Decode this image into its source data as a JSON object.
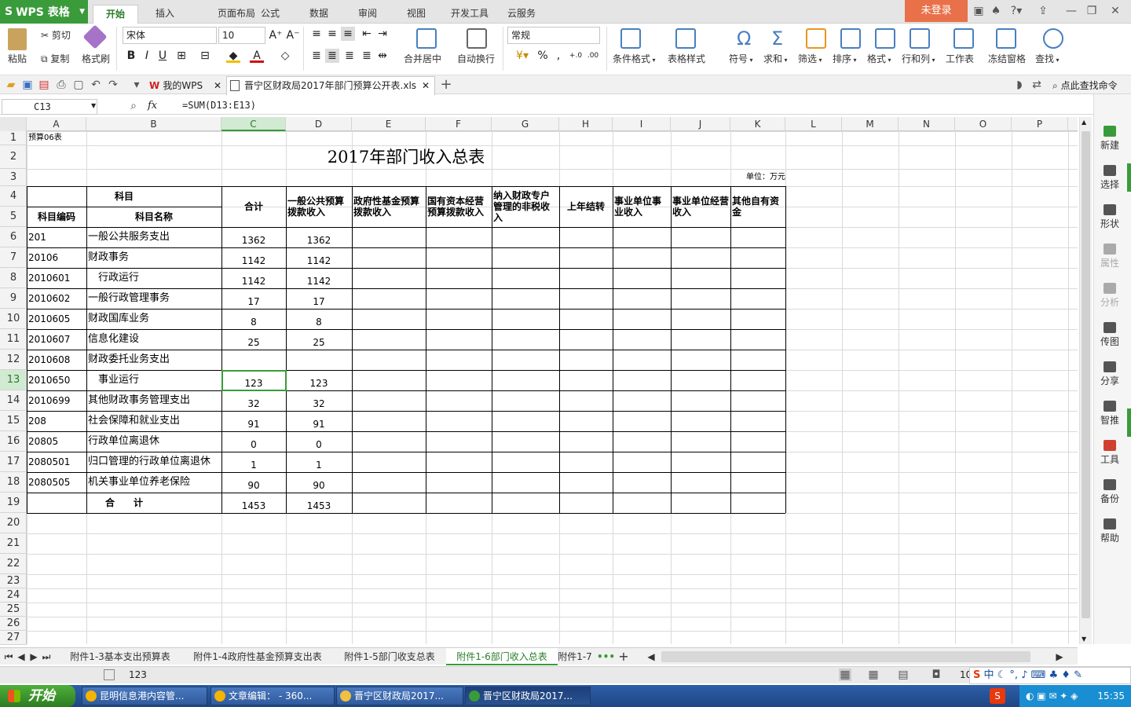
{
  "app": {
    "name": "WPS 表格",
    "login": "未登录"
  },
  "ribbon_tabs": [
    "开始",
    "插入",
    "页面布局",
    "公式",
    "数据",
    "审阅",
    "视图",
    "开发工具",
    "云服务"
  ],
  "clipboard": {
    "paste": "粘贴",
    "cut": "剪切",
    "copy": "复制",
    "format_painter": "格式刷"
  },
  "font": {
    "name": "宋体",
    "size": "10"
  },
  "alignment": {
    "merge": "合并居中",
    "wrap": "自动换行"
  },
  "number_format": "常规",
  "ribbon_right": [
    "条件格式",
    "表格样式",
    "符号",
    "求和",
    "筛选",
    "排序",
    "格式",
    "行和列",
    "工作表",
    "冻结窗格",
    "查找"
  ],
  "doc_tabs": {
    "home": "我的WPS",
    "file": "晋宁区财政局2017年部门预算公开表.xls"
  },
  "find_command": "点此查找命令",
  "formula_bar": {
    "cell_ref": "C13",
    "fx": "fx",
    "formula": "=SUM(D13:E13)"
  },
  "columns": [
    "A",
    "B",
    "C",
    "D",
    "E",
    "F",
    "G",
    "H",
    "I",
    "J",
    "K",
    "L",
    "M",
    "N",
    "O",
    "P"
  ],
  "rows": [
    "1",
    "2",
    "3",
    "4",
    "5",
    "6",
    "7",
    "8",
    "9",
    "10",
    "11",
    "12",
    "13",
    "14",
    "15",
    "16",
    "17",
    "18",
    "19",
    "20",
    "21",
    "22",
    "23",
    "24",
    "25",
    "26",
    "27"
  ],
  "sheet": {
    "note": "预算06表",
    "title": "2017年部门收入总表",
    "unit": "单位：万元",
    "header_subject": "科目",
    "header_code": "科目编码",
    "header_name": "科目名称",
    "col_headers": [
      "合计",
      "一般公共预算拨款收入",
      "政府性基金预算拨款收入",
      "国有资本经营预算拨款收入",
      "纳入财政专户管理的非税收入",
      "上年结转",
      "事业单位事业收入",
      "事业单位经营收入",
      "其他自有资金"
    ],
    "data_rows": [
      {
        "code": "201",
        "name": "一般公共服务支出",
        "total": "1362",
        "general": "1362"
      },
      {
        "code": "20106",
        "name": "财政事务",
        "total": "1142",
        "general": "1142"
      },
      {
        "code": "2010601",
        "name": "　行政运行",
        "total": "1142",
        "general": "1142"
      },
      {
        "code": "2010602",
        "name": "一般行政管理事务",
        "total": "17",
        "general": "17"
      },
      {
        "code": "2010605",
        "name": " 财政国库业务",
        "total": "8",
        "general": "8"
      },
      {
        "code": "2010607",
        "name": "信息化建设",
        "total": "25",
        "general": "25"
      },
      {
        "code": "2010608",
        "name": "财政委托业务支出",
        "total": "",
        "general": ""
      },
      {
        "code": "2010650",
        "name": "　事业运行",
        "total": "123",
        "general": "123"
      },
      {
        "code": "2010699",
        "name": "其他财政事务管理支出",
        "total": "32",
        "general": "32"
      },
      {
        "code": "208",
        "name": "社会保障和就业支出",
        "total": "91",
        "general": "91"
      },
      {
        "code": "20805",
        "name": " 行政单位离退休",
        "total": "0",
        "general": "0"
      },
      {
        "code": "2080501",
        "name": "归口管理的行政单位离退休",
        "total": "1",
        "general": "1"
      },
      {
        "code": "2080505",
        "name": "机关事业单位养老保险",
        "total": "90",
        "general": "90"
      }
    ],
    "total_label": "合　　计",
    "total_value": "1453",
    "total_general": "1453"
  },
  "sidebar": [
    "新建",
    "选择",
    "形状",
    "属性",
    "分析",
    "传图",
    "分享",
    "智推",
    "工具",
    "备份",
    "帮助"
  ],
  "sheet_tabs": [
    "附件1-3基本支出预算表",
    "附件1-4政府性基金预算支出表",
    "附件1-5部门收支总表",
    "附件1-6部门收入总表",
    "附件1-7"
  ],
  "active_sheet_index": 3,
  "status": {
    "value": "123",
    "zoom": "10"
  },
  "taskbar": {
    "start": "开始",
    "items": [
      "昆明信息港内容管...",
      "文章编辑： - 360...",
      "晋宁区财政局2017...",
      "晋宁区财政局2017..."
    ],
    "time": "15:35"
  }
}
